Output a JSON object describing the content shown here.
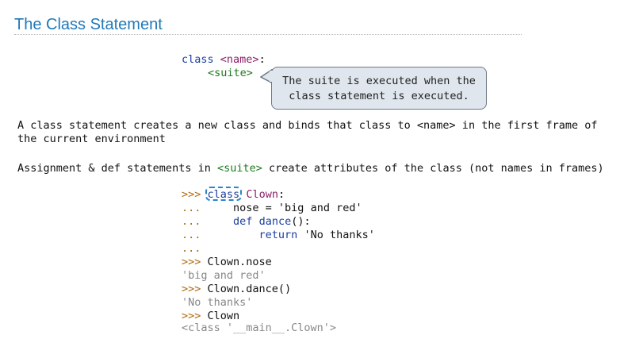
{
  "title": "The Class Statement",
  "syntax": {
    "class_kw": "class",
    "name": "<name>",
    "colon": ":",
    "suite": "<suite>"
  },
  "callout": {
    "line1": "The suite is executed when the",
    "line2": "class statement is executed."
  },
  "paragraph1": {
    "line1": "A class statement creates a new class and binds that class to <name> in the first frame of",
    "line2": "the current environment"
  },
  "paragraph2": {
    "prefix": "Assignment & def statements in ",
    "suite": "<suite>",
    "suffix": " create attributes of the class (not names in frames)"
  },
  "repl": {
    "prompt": ">>>",
    "cont": "...",
    "class_kw": "class",
    "class_name": "Clown",
    "colon": ":",
    "line2": "nose = 'big and red'",
    "def_kw": "def",
    "func_name": "dance",
    "func_rest": "():",
    "return_kw": "return",
    "return_val": "'No thanks'",
    "cmd1": "Clown.nose",
    "out1": "'big and red'",
    "cmd2": "Clown.dance()",
    "out2": "'No thanks'",
    "cmd3": "Clown",
    "out3": "<class '__main__.Clown'>"
  }
}
